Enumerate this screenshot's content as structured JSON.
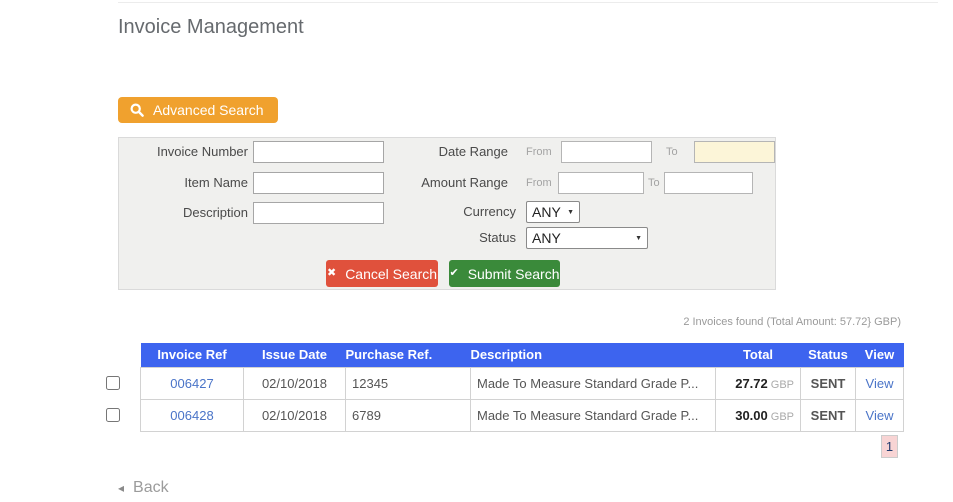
{
  "page": {
    "title": "Invoice Management",
    "back_label": "Back"
  },
  "search": {
    "toggle_label": "Advanced Search",
    "fields": {
      "invoice_number_label": "Invoice Number",
      "item_name_label": "Item Name",
      "description_label": "Description",
      "date_range_label": "Date Range",
      "amount_range_label": "Amount Range",
      "date_from_label": "From",
      "date_to_label": "To",
      "amount_from_label": "From",
      "amount_to_label": "To",
      "currency_label": "Currency",
      "currency_value": "ANY",
      "status_label": "Status",
      "status_value": "ANY"
    },
    "cancel_label": "Cancel Search",
    "submit_label": "Submit Search"
  },
  "results": {
    "summary": "2 Invoices found (Total Amount: 57.72} GBP)",
    "table": {
      "columns": [
        "Invoice Ref",
        "Issue Date",
        "Purchase Ref.",
        "Description",
        "Total",
        "Status",
        "View"
      ],
      "rows": [
        {
          "invoice_ref": "006427",
          "issue_date": "02/10/2018",
          "purchase_ref": "12345",
          "description": "Made To Measure Standard Grade P...",
          "total": "27.72",
          "currency": "GBP",
          "status": "SENT",
          "view_label": "View"
        },
        {
          "invoice_ref": "006428",
          "issue_date": "02/10/2018",
          "purchase_ref": "6789",
          "description": "Made To Measure Standard Grade P...",
          "total": "30.00",
          "currency": "GBP",
          "status": "SENT",
          "view_label": "View"
        }
      ]
    },
    "pagination": {
      "current_page": "1"
    }
  },
  "icons": {
    "cancel_glyph": "✖",
    "submit_glyph": "✔",
    "dropdown_glyph": "▼",
    "back_glyph": "◂"
  },
  "colors": {
    "accent_orange": "#f0a12e",
    "cancel_red": "#e0513c",
    "submit_green": "#3a8a3a",
    "table_header_blue": "#3d64ef",
    "link_blue": "#4a74c8",
    "status_sent_orange": "#f4511e",
    "pagination_pink": "#f8d4d4",
    "date_to_highlight_cream": "#fcf5d8"
  }
}
